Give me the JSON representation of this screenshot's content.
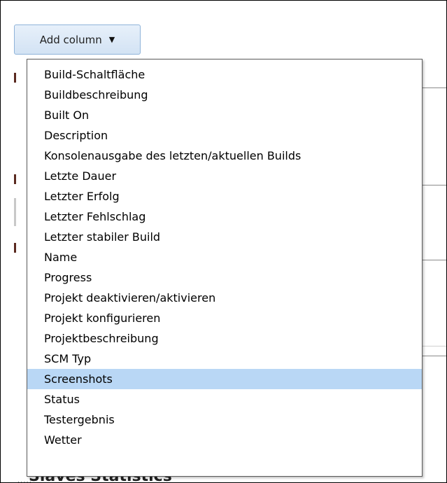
{
  "toolbar": {
    "add_column_label": "Add column",
    "caret_icon": "caret-down-icon"
  },
  "menu": {
    "selected_label": "Screenshots",
    "items": [
      {
        "label": "Build-Schaltfläche"
      },
      {
        "label": "Buildbeschreibung"
      },
      {
        "label": "Built On"
      },
      {
        "label": "Description"
      },
      {
        "label": "Konsolenausgabe des letzten/aktuellen Builds"
      },
      {
        "label": "Letzte Dauer"
      },
      {
        "label": "Letzter Erfolg"
      },
      {
        "label": "Letzter Fehlschlag"
      },
      {
        "label": "Letzter stabiler Build"
      },
      {
        "label": "Name"
      },
      {
        "label": "Progress"
      },
      {
        "label": "Projekt deaktivieren/aktivieren"
      },
      {
        "label": "Projekt konfigurieren"
      },
      {
        "label": "Projektbeschreibung"
      },
      {
        "label": "SCM Typ"
      },
      {
        "label": "Screenshots"
      },
      {
        "label": "Status"
      },
      {
        "label": "Testergebnis"
      },
      {
        "label": "Wetter"
      }
    ]
  },
  "background": {
    "footer_text": "Slaves Statistics"
  },
  "colors": {
    "highlight": "#b9d7f5",
    "button_border": "#8fb3d9",
    "menu_border": "#5a5a5a"
  }
}
